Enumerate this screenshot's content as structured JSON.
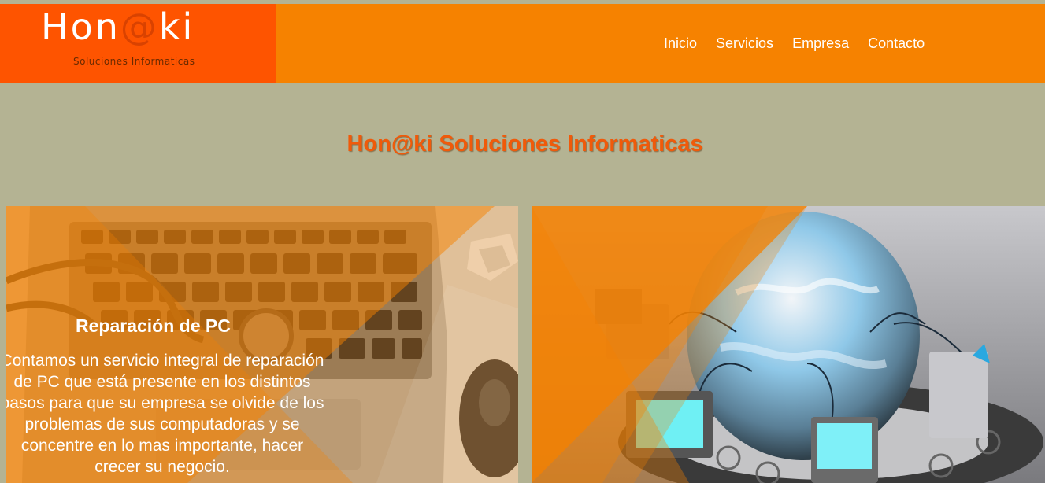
{
  "brand": {
    "name_prefix": "Hon",
    "name_at": "@",
    "name_suffix": "ki",
    "tagline": "Soluciones Informaticas"
  },
  "nav": {
    "items": [
      "Inicio",
      "Servicios",
      "Empresa",
      "Contacto"
    ]
  },
  "hero": {
    "title": "Hon@ki Soluciones Informaticas"
  },
  "services": [
    {
      "title": "Reparación de PC",
      "description": "Contamos un servicio integral de reparación de PC que está presente en los distintos pasos para que su empresa se olvide de los problemas de sus computadoras y se concentre en lo mas importante, hacer crecer su negocio."
    }
  ],
  "colors": {
    "header_bg": "#f68200",
    "logo_bg": "#fe5400",
    "page_bg": "#b4b393",
    "title_color": "#f05a0a"
  }
}
